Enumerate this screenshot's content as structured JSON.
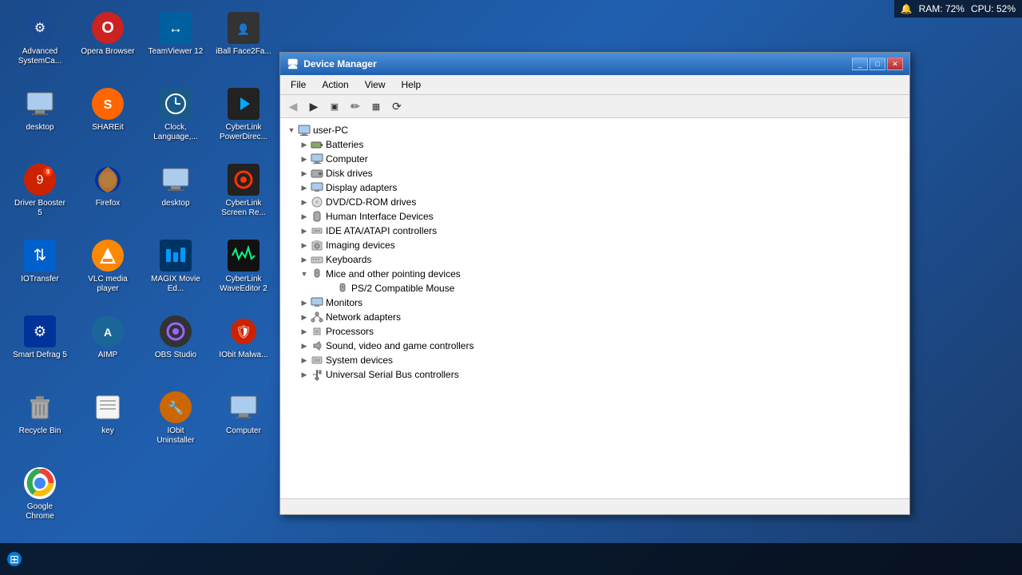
{
  "desktop": {
    "background": "blue gradient"
  },
  "system_tray": {
    "ram": "RAM: 72%",
    "cpu": "CPU: 52%"
  },
  "desktop_icons": [
    {
      "id": "advanced-systemcare",
      "label": "Advanced SystemCa...",
      "icon": "🔵",
      "row": 1,
      "col": 1
    },
    {
      "id": "opera-browser",
      "label": "Opera Browser",
      "icon": "O",
      "row": 1,
      "col": 2
    },
    {
      "id": "teamviewer12",
      "label": "TeamViewer 12",
      "icon": "↔",
      "row": 1,
      "col": 3
    },
    {
      "id": "iball-face2fa",
      "label": "iBall Face2Fa...",
      "icon": "👤",
      "row": 1,
      "col": 4
    },
    {
      "id": "desktop",
      "label": "desktop",
      "icon": "🖥",
      "row": 2,
      "col": 1
    },
    {
      "id": "shareit",
      "label": "SHAREit",
      "icon": "S",
      "row": 2,
      "col": 2
    },
    {
      "id": "clock-language",
      "label": "Clock, Language,...",
      "icon": "🕐",
      "row": 2,
      "col": 3
    },
    {
      "id": "cyberlink-powerdirect",
      "label": "CyberLink PowerDirec...",
      "icon": "▶",
      "row": 2,
      "col": 4
    },
    {
      "id": "driver-booster5",
      "label": "Driver Booster 5",
      "icon": "🔴",
      "row": 3,
      "col": 1
    },
    {
      "id": "firefox",
      "label": "Firefox",
      "icon": "🦊",
      "row": 3,
      "col": 2
    },
    {
      "id": "desktop2",
      "label": "desktop",
      "icon": "🖥",
      "row": 3,
      "col": 3
    },
    {
      "id": "cyberlink-screenre",
      "label": "CyberLink Screen Re...",
      "icon": "📹",
      "row": 3,
      "col": 4
    },
    {
      "id": "iotransfer",
      "label": "IOTransfer",
      "icon": "↕",
      "row": 4,
      "col": 1
    },
    {
      "id": "vlc",
      "label": "VLC media player",
      "icon": "🔶",
      "row": 4,
      "col": 2
    },
    {
      "id": "magix-movieed",
      "label": "MAGIX Movie Ed...",
      "icon": "🎬",
      "row": 4,
      "col": 3
    },
    {
      "id": "cyberlink-waveeditor2",
      "label": "CyberLink WaveEditor 2",
      "icon": "🎵",
      "row": 4,
      "col": 4
    },
    {
      "id": "smart-defrag5",
      "label": "Smart Defrag 5",
      "icon": "⚙",
      "row": 5,
      "col": 1
    },
    {
      "id": "aimp",
      "label": "AIMP",
      "icon": "🎵",
      "row": 5,
      "col": 2
    },
    {
      "id": "obs-studio",
      "label": "OBS Studio",
      "icon": "⏺",
      "row": 5,
      "col": 3
    },
    {
      "id": "iobit-malware",
      "label": "IObit Malwa...",
      "icon": "🛡",
      "row": 6,
      "col": 1
    },
    {
      "id": "recycle-bin",
      "label": "Recycle Bin",
      "icon": "🗑",
      "row": 6,
      "col": 2
    },
    {
      "id": "key",
      "label": "key",
      "icon": "📄",
      "row": 6,
      "col": 3
    },
    {
      "id": "iobit-uninstaller",
      "label": "IObit Uninstaller",
      "icon": "🔧",
      "row": 7,
      "col": 1
    },
    {
      "id": "computer",
      "label": "Computer",
      "icon": "💻",
      "row": 7,
      "col": 2
    },
    {
      "id": "google-chrome",
      "label": "Google Chrome",
      "icon": "🌐",
      "row": 7,
      "col": 3
    }
  ],
  "window": {
    "title": "Device Manager",
    "title_icon": "🖥",
    "menu_items": [
      "File",
      "Action",
      "View",
      "Help"
    ],
    "toolbar_buttons": [
      "◀",
      "▶",
      "▣",
      "✏",
      "▦",
      "⟳"
    ],
    "root_node": "user-PC",
    "tree_items": [
      {
        "label": "Batteries",
        "icon": "🔋",
        "indent": 1,
        "expanded": false,
        "children": []
      },
      {
        "label": "Computer",
        "icon": "💻",
        "indent": 1,
        "expanded": false,
        "children": []
      },
      {
        "label": "Disk drives",
        "icon": "💾",
        "indent": 1,
        "expanded": false,
        "children": []
      },
      {
        "label": "Display adapters",
        "icon": "🖵",
        "indent": 1,
        "expanded": false,
        "children": []
      },
      {
        "label": "DVD/CD-ROM drives",
        "icon": "💿",
        "indent": 1,
        "expanded": false,
        "children": []
      },
      {
        "label": "Human Interface Devices",
        "icon": "🖱",
        "indent": 1,
        "expanded": false,
        "children": []
      },
      {
        "label": "IDE ATA/ATAPI controllers",
        "icon": "⚙",
        "indent": 1,
        "expanded": false,
        "children": []
      },
      {
        "label": "Imaging devices",
        "icon": "📷",
        "indent": 1,
        "expanded": false,
        "children": []
      },
      {
        "label": "Keyboards",
        "icon": "⌨",
        "indent": 1,
        "expanded": false,
        "children": []
      },
      {
        "label": "Mice and other pointing devices",
        "icon": "🖱",
        "indent": 1,
        "expanded": true,
        "children": [
          {
            "label": "PS/2 Compatible Mouse",
            "icon": "🖱",
            "indent": 2,
            "expanded": false,
            "children": []
          }
        ]
      },
      {
        "label": "Monitors",
        "icon": "🖥",
        "indent": 1,
        "expanded": false,
        "children": []
      },
      {
        "label": "Network adapters",
        "icon": "🌐",
        "indent": 1,
        "expanded": false,
        "children": []
      },
      {
        "label": "Processors",
        "icon": "⚙",
        "indent": 1,
        "expanded": false,
        "children": []
      },
      {
        "label": "Sound, video and game controllers",
        "icon": "🔊",
        "indent": 1,
        "expanded": false,
        "children": []
      },
      {
        "label": "System devices",
        "icon": "⚙",
        "indent": 1,
        "expanded": false,
        "children": []
      },
      {
        "label": "Universal Serial Bus controllers",
        "icon": "🔌",
        "indent": 1,
        "expanded": false,
        "children": []
      }
    ]
  }
}
